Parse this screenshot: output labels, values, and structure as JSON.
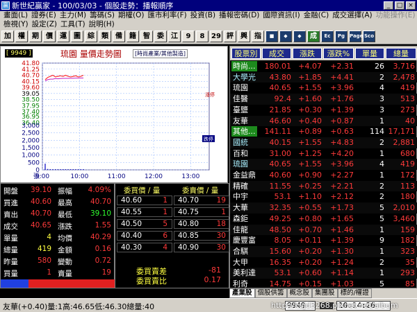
{
  "window": {
    "title": "新世紀贏家 - 100/03/03 - 個股走勢：播報順序",
    "min": "_",
    "max": "□",
    "close": "×",
    "app_icon": "贏"
  },
  "menu": {
    "row1": [
      "畫面(L)",
      "證券(E)",
      "主力(M)",
      "籌碼(S)",
      "期權(O)",
      "匯市利率(F)",
      "投資(B)",
      "播報密碼(D)",
      "國際資訊(I)",
      "金融(C)",
      "成交選擇(A)",
      "功能操作(E)"
    ],
    "row2": [
      "檢視(Y)",
      "設定(Z)",
      "工具(T)",
      "說明(H)"
    ]
  },
  "toolbar": {
    "buttons": [
      "加",
      "權",
      "期",
      "價",
      "運",
      "圖",
      "綜",
      "類",
      "備",
      "籍",
      "智",
      "委",
      "江",
      "9",
      "8",
      "29",
      "評",
      "興",
      "指",
      "■",
      "◆",
      "◆",
      "成",
      "Ec",
      "Pg",
      "Page",
      "Sco"
    ]
  },
  "chart": {
    "code": "[ 9949 ]",
    "title": "琉園  量價走勢圖",
    "sector": "[時尚產業/其他製造]",
    "price_labels": [
      "41.80",
      "41.25",
      "40.70",
      "40.15",
      "39.60",
      "39.05",
      "38.50",
      "37.95",
      "37.40",
      "36.95",
      "36.40"
    ],
    "vol_labels": [
      "3,000",
      "2,500",
      "2,000",
      "1,500",
      "1,000",
      "500",
      "0"
    ],
    "vol_unit": "張",
    "time_labels": [
      "9:00",
      "10:00",
      "11:00",
      "12:00",
      "13:00"
    ],
    "tag_upper": "漲停",
    "tag_lower": "跌停",
    "price_series": [
      40.3,
      40.5,
      40.6,
      40.7,
      40.55,
      40.6,
      40.65,
      40.6,
      40.7,
      40.6,
      40.55,
      40.6,
      40.65,
      40.55,
      40.6,
      40.7
    ],
    "avg_series": [
      40.2,
      40.3,
      40.35,
      40.35,
      40.4,
      40.38,
      40.4,
      40.42,
      40.42,
      40.42,
      40.43,
      40.43,
      40.44,
      40.44,
      40.45,
      40.45
    ],
    "volumes": [
      420,
      60,
      30,
      25,
      40,
      20,
      18,
      15,
      22,
      18,
      12,
      15,
      20,
      14,
      18,
      10
    ],
    "colors": {
      "price": "#ff3030",
      "avg": "#c020c0",
      "grid": "#a0c0ff",
      "volume": "#0000c0"
    }
  },
  "quote": {
    "rows": [
      {
        "l1": "開盤",
        "v1": "39.10",
        "l2": "振幅",
        "v2": "4.09%"
      },
      {
        "l1": "買進",
        "v1": "40.60",
        "l2": "最高",
        "v2": "40.70"
      },
      {
        "l1": "賣出",
        "v1": "40.70",
        "l2": "最低",
        "v2": "39.10"
      },
      {
        "l1": "成交",
        "v1": "40.65",
        "l2": "漲跌",
        "v2": "1.55"
      },
      {
        "l1": "單量",
        "v1": "4",
        "l2": "均價",
        "v2": "40.29"
      },
      {
        "l1": "總量",
        "v1": "419",
        "l2": "金額",
        "v2": "0.16"
      },
      {
        "l1": "昨量",
        "v1": "580",
        "l2": "變動",
        "v2": "0.72"
      },
      {
        "l1": "買量",
        "v1": "1",
        "l2": "賣量",
        "v2": "19"
      }
    ]
  },
  "bids": {
    "head_buy": "委買價 / 量",
    "head_sell": "委賣價 / 量",
    "buy": [
      {
        "p": "40.60",
        "q": "1"
      },
      {
        "p": "40.55",
        "q": "1"
      },
      {
        "p": "40.50",
        "q": "5"
      },
      {
        "p": "40.40",
        "q": "6"
      },
      {
        "p": "40.30",
        "q": "4"
      }
    ],
    "sell": [
      {
        "p": "40.70",
        "q": "19"
      },
      {
        "p": "40.75",
        "q": "1"
      },
      {
        "p": "40.80",
        "q": "18"
      },
      {
        "p": "40.85",
        "q": "30"
      },
      {
        "p": "40.90",
        "q": "30"
      }
    ],
    "diff_label": "委買賣差",
    "diff_value": "-81",
    "ratio_label": "委買賣比",
    "ratio_value": "0.17"
  },
  "watch": {
    "headers": [
      "股票別",
      "成交",
      "漲跌",
      "漲跌%",
      "單量",
      "總量"
    ],
    "rows": [
      {
        "name": "時尚...",
        "price": "180.01",
        "chg": "+4.07",
        "pct": "+2.31",
        "vol": "26",
        "total": "3,716",
        "hl": true
      },
      {
        "name": "大學光",
        "price": "43.80",
        "chg": "+1.85",
        "pct": "+4.41",
        "vol": "2",
        "total": "2,478"
      },
      {
        "name": "琉園",
        "price": "40.65",
        "chg": "+1.55",
        "pct": "+3.96",
        "vol": "4",
        "total": "419"
      },
      {
        "name": "佳醫",
        "price": "92.4",
        "chg": "+1.60",
        "pct": "+1.76",
        "vol": "3",
        "total": "513"
      },
      {
        "name": "臺鹽",
        "price": "21.85",
        "chg": "+0.30",
        "pct": "+1.39",
        "vol": "3",
        "total": "273"
      },
      {
        "name": "友華",
        "price": "46.60",
        "chg": "+0.40",
        "pct": "+0.87",
        "vol": "1",
        "total": "40"
      },
      {
        "name": "其他...",
        "price": "141.11",
        "chg": "+0.89",
        "pct": "+0.63",
        "vol": "114",
        "total": "17,171",
        "hl": true
      },
      {
        "name": "國統",
        "price": "40.15",
        "chg": "+1.55",
        "pct": "+4.83",
        "vol": "2",
        "total": "2,881"
      },
      {
        "name": "百和",
        "price": "31.00",
        "chg": "+1.25",
        "pct": "+4.20",
        "vol": "1",
        "total": "680"
      },
      {
        "name": "琉園",
        "price": "40.65",
        "chg": "+1.55",
        "pct": "+3.96",
        "vol": "4",
        "total": "419"
      },
      {
        "name": "金益鼎",
        "price": "40.60",
        "chg": "+0.90",
        "pct": "+2.27",
        "vol": "1",
        "total": "172"
      },
      {
        "name": "精確",
        "price": "11.55",
        "chg": "+0.25",
        "pct": "+2.21",
        "vol": "2",
        "total": "113"
      },
      {
        "name": "中宇",
        "price": "53.1",
        "chg": "+1.10",
        "pct": "+2.12",
        "vol": "2",
        "total": "180"
      },
      {
        "name": "大華",
        "price": "32.35",
        "chg": "+0.55",
        "pct": "+1.73",
        "vol": "5",
        "total": "2,010"
      },
      {
        "name": "森鉅",
        "price": "49.25",
        "chg": "+0.80",
        "pct": "+1.65",
        "vol": "5",
        "total": "3,460"
      },
      {
        "name": "佳龍",
        "price": "48.50",
        "chg": "+0.70",
        "pct": "+1.46",
        "vol": "1",
        "total": "159"
      },
      {
        "name": "慶豐富",
        "price": "8.05",
        "chg": "+0.11",
        "pct": "+1.39",
        "vol": "9",
        "total": "182"
      },
      {
        "name": "合騏",
        "price": "15.60",
        "chg": "+0.20",
        "pct": "+1.30",
        "vol": "1",
        "total": "323"
      },
      {
        "name": "大甲",
        "price": "16.35",
        "chg": "+0.20",
        "pct": "+1.24",
        "vol": "2",
        "total": "35"
      },
      {
        "name": "美利達",
        "price": "53.1",
        "chg": "+0.60",
        "pct": "+1.14",
        "vol": "1",
        "total": "293"
      },
      {
        "name": "利奇",
        "price": "14.75",
        "chg": "+0.15",
        "pct": "+1.03",
        "vol": "5",
        "total": "85"
      }
    ]
  },
  "tabs": [
    "產業股",
    "個股供籌",
    "概念股",
    "集團股",
    "標的/權證"
  ],
  "status": {
    "text": "友華(+0.40)量:1高:46.65低:46.30總量:40",
    "code": "9949",
    "time": "10:14:26"
  },
  "watermark": "http://kujd3268.pixnet.net/album",
  "taskbar": {
    "start": "開始"
  }
}
